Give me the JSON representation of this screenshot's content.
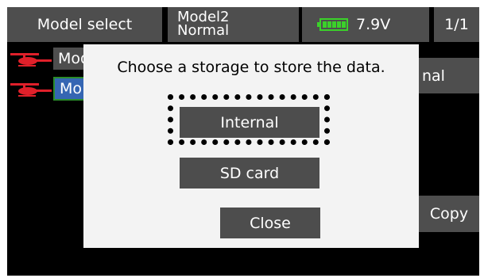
{
  "header": {
    "title": "Model select",
    "model_name": "Model2",
    "model_condition": "Normal",
    "battery_voltage": "7.9V",
    "page_indicator": "1/1"
  },
  "model_list": {
    "items": [
      {
        "label": "Mod",
        "selected": false
      },
      {
        "label": "Mo",
        "selected": true
      }
    ],
    "right_partial_text": "nal",
    "copy_label": "Copy"
  },
  "dialog": {
    "message": "Choose a storage to store the data.",
    "options": [
      "Internal",
      "SD card"
    ],
    "focused_option": "Internal",
    "close_label": "Close"
  },
  "colors": {
    "header_bg": "#4e4e4e",
    "selected_bg": "#3566b3",
    "battery": "#3bd12a",
    "heli": "#e0202a",
    "dialog_bg": "#f3f3f3"
  }
}
